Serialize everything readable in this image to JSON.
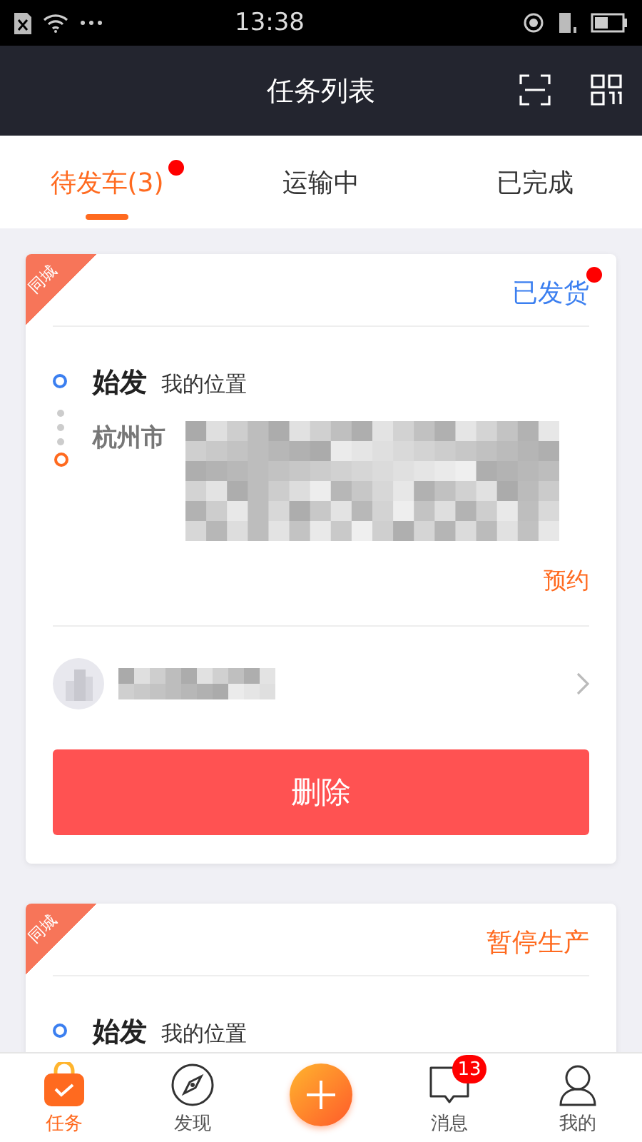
{
  "status_bar": {
    "time": "13:38"
  },
  "header": {
    "title": "任务列表"
  },
  "tabs": [
    {
      "label": "待发车(3)",
      "selected": true,
      "dot": true
    },
    {
      "label": "运输中",
      "selected": false,
      "dot": false
    },
    {
      "label": "已完成",
      "selected": false,
      "dot": false
    }
  ],
  "cards": [
    {
      "tag": "同城",
      "status": {
        "text": "已发货",
        "color": "#3b7ff0",
        "dot": true
      },
      "origin": {
        "label": "始发",
        "place": "我的位置"
      },
      "destination": {
        "city": "杭州市",
        "address_blurred": true
      },
      "action": "预约",
      "company": {
        "name_blurred": true
      },
      "button": "删除"
    },
    {
      "tag": "同城",
      "status": {
        "text": "暂停生产",
        "color": "#ff6a1f",
        "dot": false
      },
      "origin": {
        "label": "始发",
        "place": "我的位置"
      }
    }
  ],
  "bottom_nav": [
    {
      "kind": "tab",
      "label": "任务",
      "selected": true
    },
    {
      "kind": "tab",
      "label": "发现",
      "selected": false
    },
    {
      "kind": "add"
    },
    {
      "kind": "tab",
      "label": "消息",
      "selected": false,
      "badge": "13"
    },
    {
      "kind": "tab",
      "label": "我的",
      "selected": false
    }
  ]
}
